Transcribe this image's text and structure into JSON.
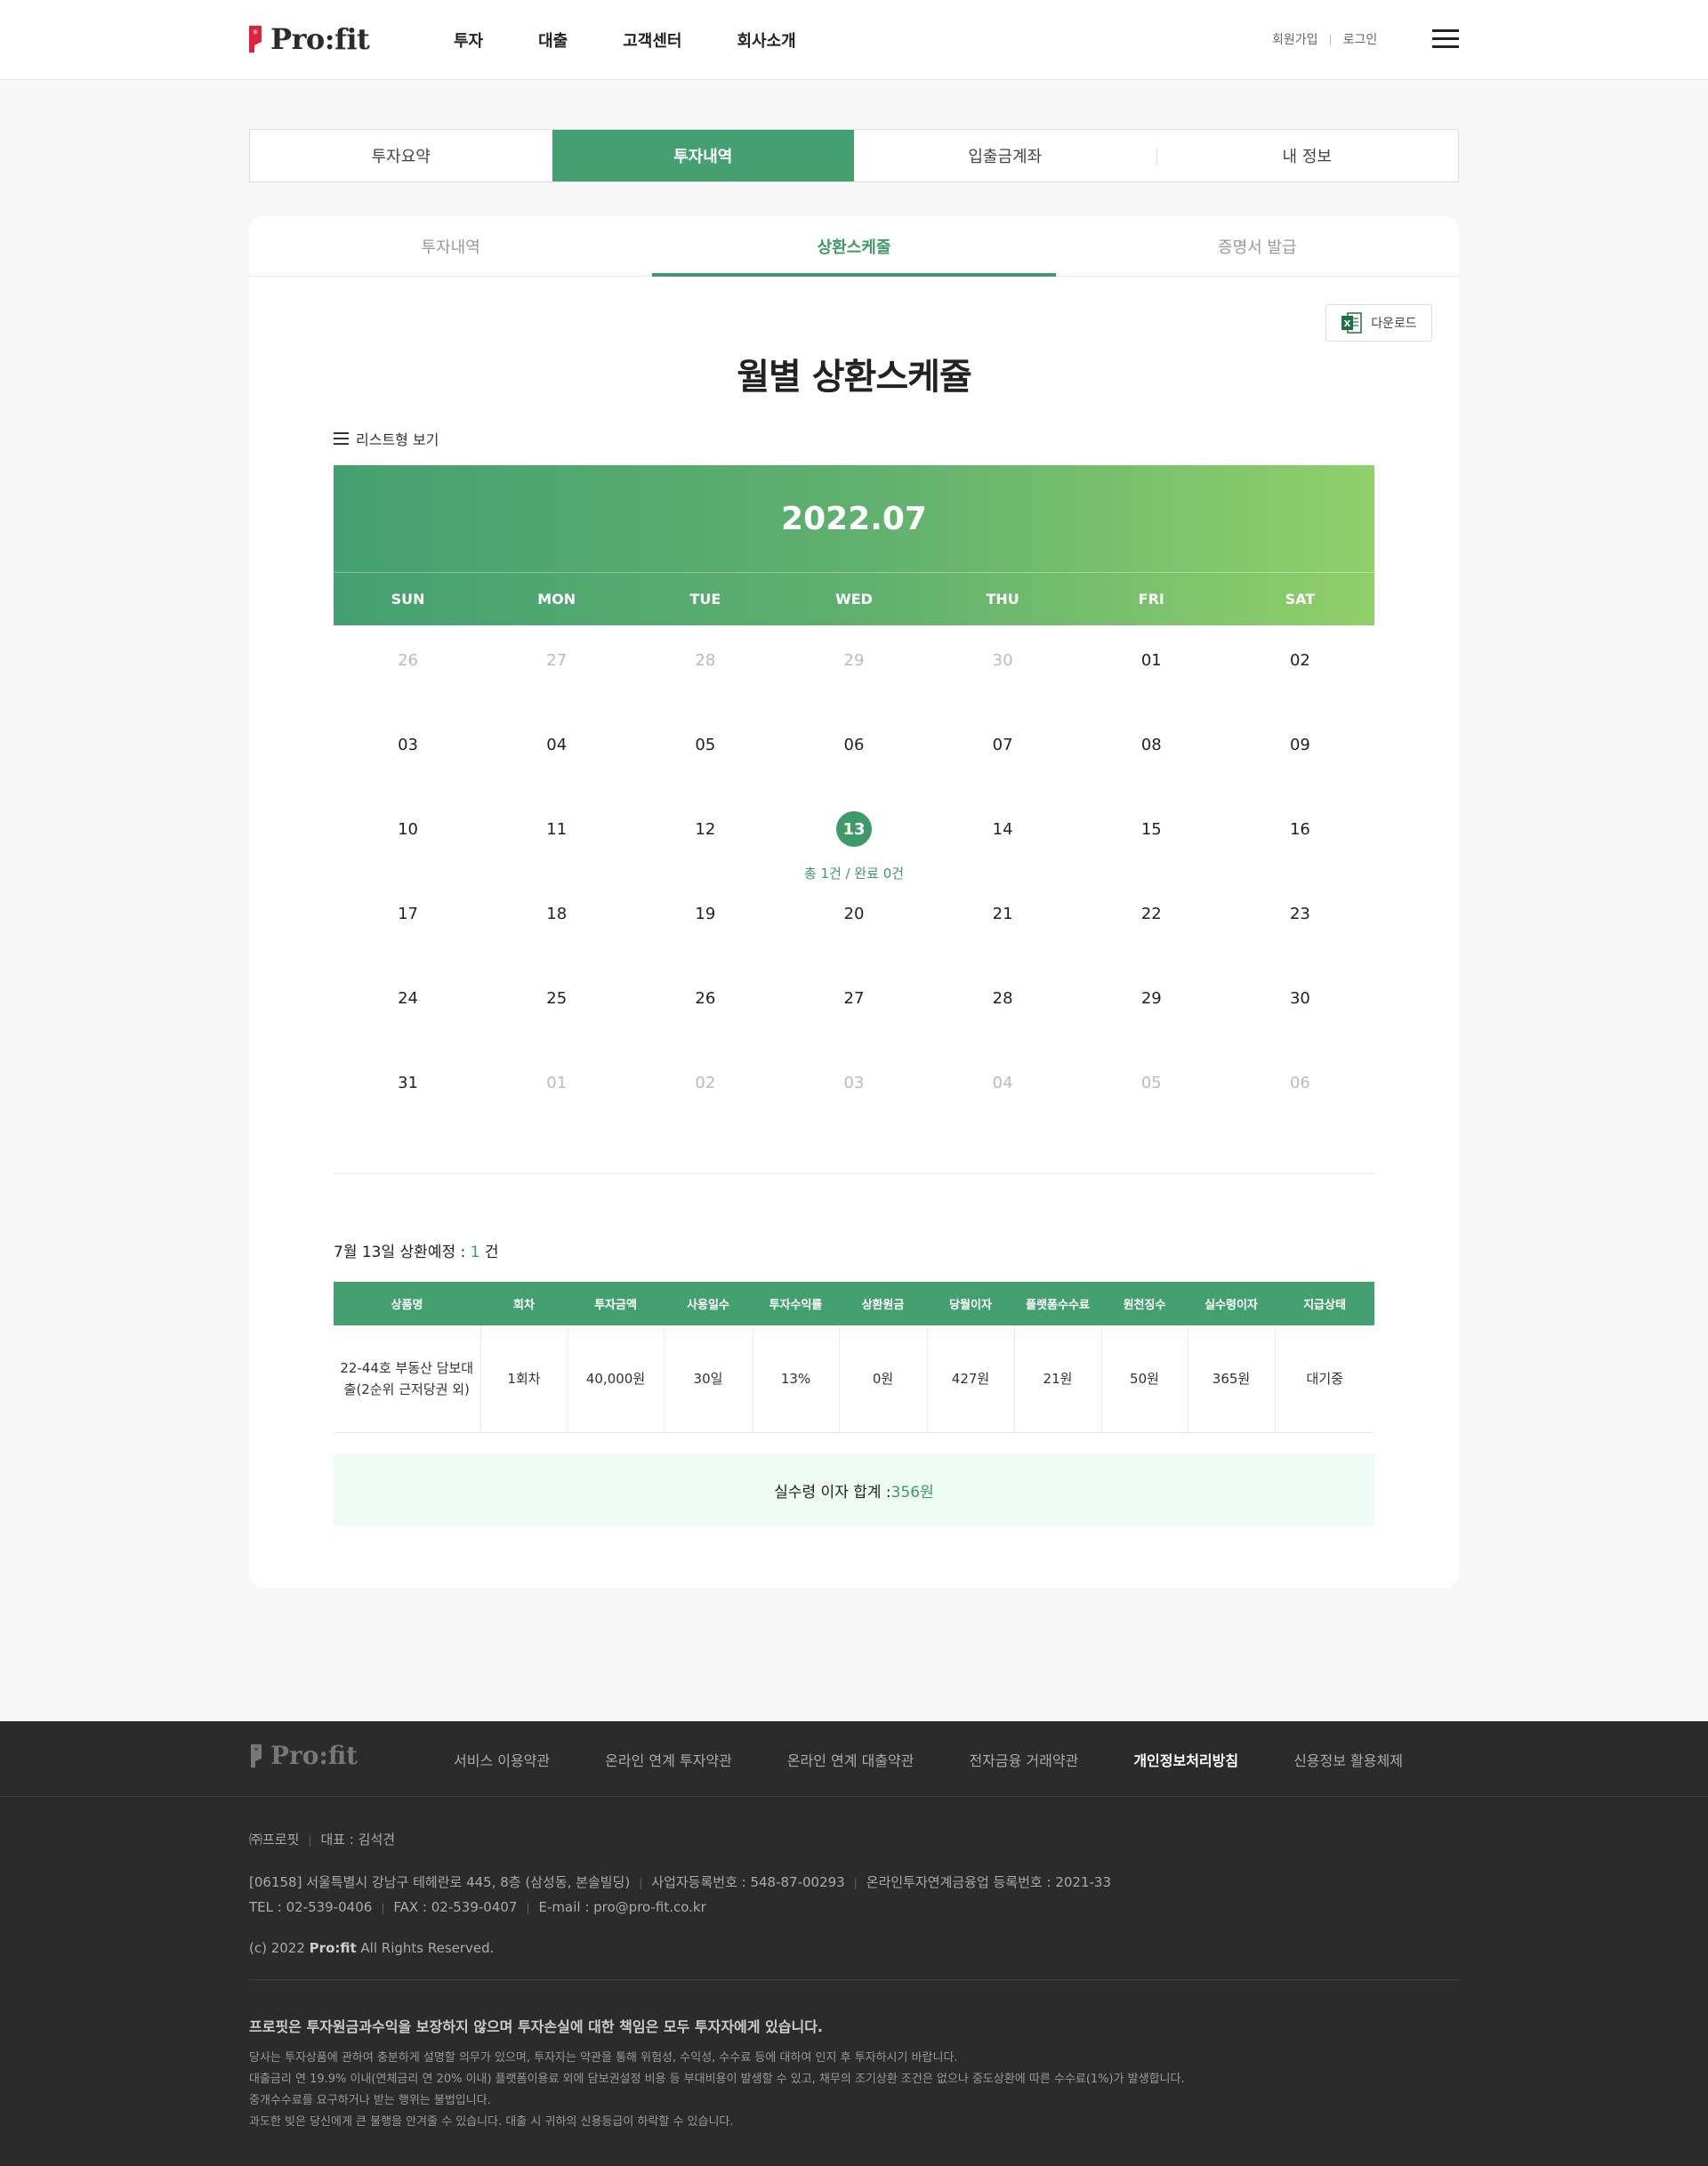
{
  "brand": {
    "name": "Pro:fit",
    "accent": "#44a070",
    "accent_dark": "#3e9a68",
    "logo_red": "#e0213a"
  },
  "header": {
    "nav": [
      "투자",
      "대출",
      "고객센터",
      "회사소개"
    ],
    "util": {
      "signup": "회원가입",
      "login": "로그인"
    },
    "menu_icon": "hamburger-icon"
  },
  "main_tabs": [
    {
      "label": "투자요약",
      "active": false
    },
    {
      "label": "투자내역",
      "active": true
    },
    {
      "label": "입출금계좌",
      "active": false
    },
    {
      "label": "내 정보",
      "active": false
    }
  ],
  "sub_tabs": [
    {
      "label": "투자내역",
      "active": false
    },
    {
      "label": "상환스케줄",
      "active": true
    },
    {
      "label": "증명서 발급",
      "active": false
    }
  ],
  "download": {
    "label": "다운로드",
    "icon": "excel-icon"
  },
  "calendar": {
    "title": "월별 상환스케쥴",
    "list_view": "리스트형 보기",
    "month": "2022.07",
    "weekdays": [
      "SUN",
      "MON",
      "TUE",
      "WED",
      "THU",
      "FRI",
      "SAT"
    ],
    "weeks": [
      [
        {
          "d": "26",
          "m": true
        },
        {
          "d": "27",
          "m": true
        },
        {
          "d": "28",
          "m": true
        },
        {
          "d": "29",
          "m": true
        },
        {
          "d": "30",
          "m": true
        },
        {
          "d": "01"
        },
        {
          "d": "02"
        }
      ],
      [
        {
          "d": "03"
        },
        {
          "d": "04"
        },
        {
          "d": "05"
        },
        {
          "d": "06"
        },
        {
          "d": "07"
        },
        {
          "d": "08"
        },
        {
          "d": "09"
        }
      ],
      [
        {
          "d": "10"
        },
        {
          "d": "11"
        },
        {
          "d": "12"
        },
        {
          "d": "13",
          "sel": true,
          "note": "총 1건 / 완료 0건"
        },
        {
          "d": "14"
        },
        {
          "d": "15"
        },
        {
          "d": "16"
        }
      ],
      [
        {
          "d": "17"
        },
        {
          "d": "18"
        },
        {
          "d": "19"
        },
        {
          "d": "20"
        },
        {
          "d": "21"
        },
        {
          "d": "22"
        },
        {
          "d": "23"
        }
      ],
      [
        {
          "d": "24"
        },
        {
          "d": "25"
        },
        {
          "d": "26"
        },
        {
          "d": "27"
        },
        {
          "d": "28"
        },
        {
          "d": "29"
        },
        {
          "d": "30"
        }
      ],
      [
        {
          "d": "31"
        },
        {
          "d": "01",
          "m": true
        },
        {
          "d": "02",
          "m": true
        },
        {
          "d": "03",
          "m": true
        },
        {
          "d": "04",
          "m": true
        },
        {
          "d": "05",
          "m": true
        },
        {
          "d": "06",
          "m": true
        }
      ]
    ]
  },
  "schedule": {
    "title_prefix": "7월 13일 상환예정 : ",
    "count": "1",
    "count_suffix": " 건",
    "columns": [
      "상품명",
      "회차",
      "투자금액",
      "사용일수",
      "투자수익률",
      "상환원금",
      "당월이자",
      "플랫폼수수료",
      "원천징수",
      "실수령이자",
      "지급상태"
    ],
    "rows": [
      [
        "22-44호 부동산 담보대출(2순위 근저당권 외)",
        "1회차",
        "40,000원",
        "30일",
        "13%",
        "0원",
        "427원",
        "21원",
        "50원",
        "365원",
        "대기중"
      ]
    ],
    "total_label": "실수령 이자 합계 : ",
    "total_amount": "356원"
  },
  "footer": {
    "links": [
      {
        "label": "서비스 이용약관",
        "strong": false
      },
      {
        "label": "온라인 연계 투자약관",
        "strong": false
      },
      {
        "label": "온라인 연계 대출약관",
        "strong": false
      },
      {
        "label": "전자금융 거래약관",
        "strong": false
      },
      {
        "label": "개인정보처리방침",
        "strong": true
      },
      {
        "label": "신용정보 활용체제",
        "strong": false
      }
    ],
    "company": "㈜프로핏",
    "ceo": "대표 : 김석견",
    "address": "[06158] 서울특별시 강남구 테헤란로 445, 8층 (삼성동, 본솔빌딩)",
    "biz_no": "사업자등록번호 : 548-87-00293",
    "p2p_no": "온라인투자연계금융업 등록번호 : 2021-33",
    "tel": "TEL : 02-539-0406",
    "fax": "FAX : 02-539-0407",
    "email": "E-mail : pro@pro-fit.co.kr",
    "copyright_prefix": "(c) 2022 ",
    "copyright_brand": "Pro:fit",
    "copyright_suffix": " All Rights Reserved.",
    "warning_title": "프로핏은 투자원금과수익을 보장하지 않으며 투자손실에 대한 책임은 모두 투자자에게 있습니다.",
    "warnings": [
      "당사는 투자상품에 관하여 충분하게 설명할 의무가 있으며, 투자자는 약관을 통해 위험성, 수익성, 수수료 등에 대하여 인지 후 투자하시기 바랍니다.",
      "대출금리 연 19.9% 이내(연체금리 연 20% 이내) 플랫폼이용료 외에 담보권설정 비용 등 부대비용이 발생할 수 있고, 채무의 조기상환 조건은 없으나 중도상환에 따른 수수료(1%)가 발생합니다.",
      "중개수수료를 요구하거나 받는 행위는 불법입니다.",
      "과도한 빚은 당신에게 큰 불행을 안겨줄 수 있습니다. 대출 시 귀하의 신용등급이 하락할 수 있습니다."
    ]
  }
}
